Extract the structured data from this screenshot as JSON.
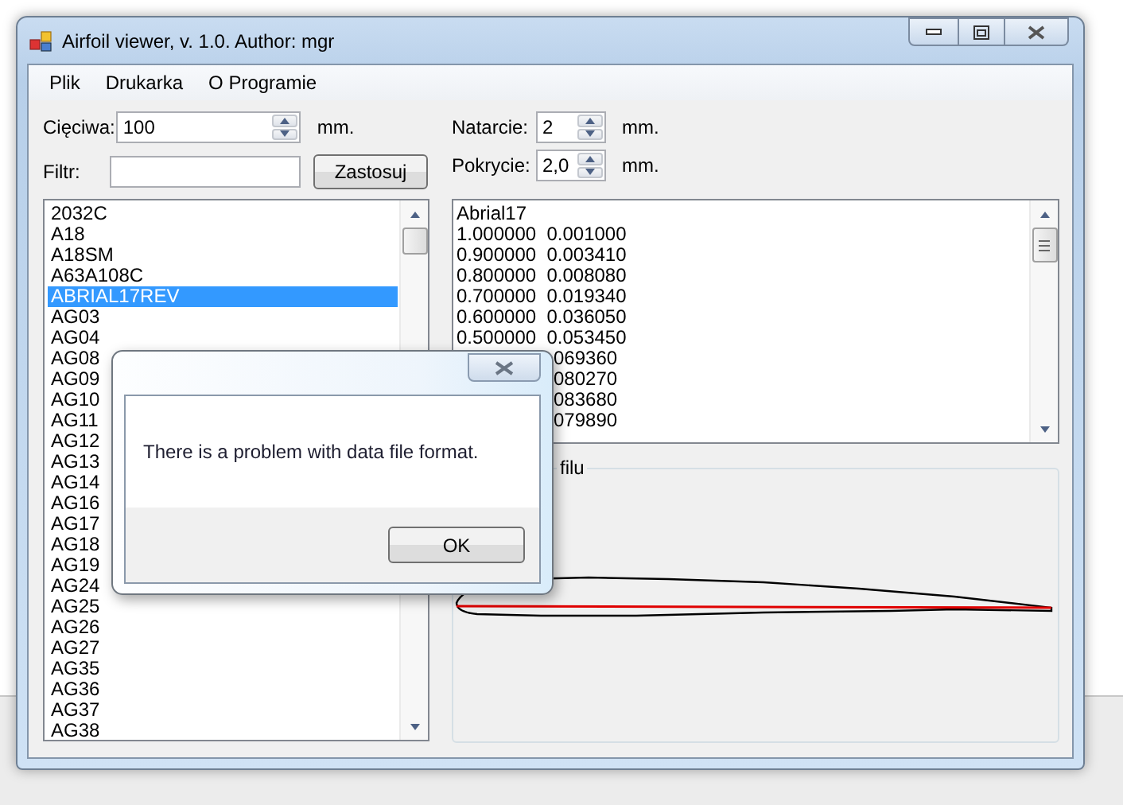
{
  "window": {
    "title": "Airfoil viewer, v. 1.0. Author: mgr"
  },
  "menu": [
    "Plik",
    "Drukarka",
    "O Programie"
  ],
  "chord": {
    "label": "Cięciwa:",
    "value": "100",
    "unit": "mm."
  },
  "filter": {
    "label": "Filtr:",
    "button": "Zastosuj"
  },
  "leading_edge": {
    "label": "Natarcie:",
    "value": "2",
    "unit": "mm."
  },
  "covering": {
    "label": "Pokrycie:",
    "value": "2,0",
    "unit": "mm."
  },
  "airfoil_list": [
    {
      "name": "2032C",
      "selected": false
    },
    {
      "name": "A18",
      "selected": false
    },
    {
      "name": "A18SM",
      "selected": false
    },
    {
      "name": "A63A108C",
      "selected": false
    },
    {
      "name": "ABRIAL17REV",
      "selected": true
    },
    {
      "name": "AG03",
      "selected": false
    },
    {
      "name": "AG04",
      "selected": false
    },
    {
      "name": "AG08",
      "selected": false
    },
    {
      "name": "AG09",
      "selected": false
    },
    {
      "name": "AG10",
      "selected": false
    },
    {
      "name": "AG11",
      "selected": false
    },
    {
      "name": "AG12",
      "selected": false
    },
    {
      "name": "AG13",
      "selected": false
    },
    {
      "name": "AG14",
      "selected": false
    },
    {
      "name": "AG16",
      "selected": false
    },
    {
      "name": "AG17",
      "selected": false
    },
    {
      "name": "AG18",
      "selected": false
    },
    {
      "name": "AG19",
      "selected": false
    },
    {
      "name": "AG24",
      "selected": false
    },
    {
      "name": "AG25",
      "selected": false
    },
    {
      "name": "AG26",
      "selected": false
    },
    {
      "name": "AG27",
      "selected": false
    },
    {
      "name": "AG35",
      "selected": false
    },
    {
      "name": "AG36",
      "selected": false
    },
    {
      "name": "AG37",
      "selected": false
    },
    {
      "name": "AG38",
      "selected": false
    }
  ],
  "coordinates_text": [
    {
      "kind": "full",
      "text": "Abrial17"
    },
    {
      "kind": "full",
      "text": "1.000000  0.001000"
    },
    {
      "kind": "full",
      "text": "0.900000  0.003410"
    },
    {
      "kind": "full",
      "text": "0.800000  0.008080"
    },
    {
      "kind": "full",
      "text": "0.700000  0.019340"
    },
    {
      "kind": "full",
      "text": "0.600000  0.036050"
    },
    {
      "kind": "full",
      "text": "0.500000  0.053450"
    },
    {
      "kind": "tail",
      "text": "069360"
    },
    {
      "kind": "tail",
      "text": "080270"
    },
    {
      "kind": "tail",
      "text": "083680"
    },
    {
      "kind": "tail",
      "text": "079890"
    }
  ],
  "profile_group": {
    "label": "filu"
  },
  "dialog": {
    "message": "There is a problem with data file format.",
    "button": "OK"
  }
}
